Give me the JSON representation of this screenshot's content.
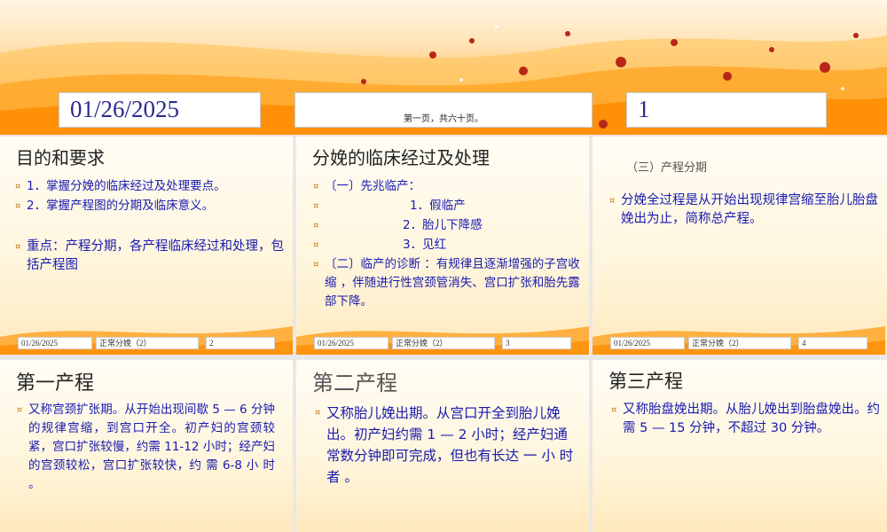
{
  "header": {
    "date": "01/26/2025",
    "page_info": "第一页，共六十页。",
    "page_number": "1"
  },
  "slides": [
    {
      "title": "目的和要求",
      "bullets": [
        "1．掌握分娩的临床经过及处理要点。",
        "2．掌握产程图的分期及临床意义。",
        "重点：产程分期，各产程临床经过和处理，包括产程图"
      ],
      "footer": {
        "date": "01/26/2025",
        "course": "正常分娩（2）",
        "page": "2"
      }
    },
    {
      "title": "分娩的临床经过及处理",
      "bullets": [
        "〔一〕先兆临产：",
        "1．假临产",
        "2．胎儿下降感",
        "3．见红",
        "〔二〕临产的诊断 ：有规律且逐渐增强的子宫收缩 ，伴随进行性宫颈管消失、宫口扩张和胎先露部下降。"
      ],
      "footer": {
        "date": "01/26/2025",
        "course": "正常分娩（2）",
        "page": "3"
      }
    },
    {
      "subtitle": "（三）产程分期",
      "bullets": [
        "分娩全过程是从开始出现规律宫缩至胎儿胎盘娩出为止，简称总产程。"
      ],
      "footer": {
        "date": "01/26/2025",
        "course": "正常分娩（2）",
        "page": "4"
      }
    },
    {
      "title": "第一产程",
      "bullets": [
        "又称宫颈扩张期。从开始出现间歇 5 — 6 分钟的规律宫缩，到宫口开全。初产妇的宫颈较紧，宫口扩张较慢，约需 11-12 小时；经产妇的宫颈较松，宫口扩张较快，约 需 6-8 小 时 。"
      ]
    },
    {
      "title": "第二产程",
      "bullets": [
        "又称胎儿娩出期。从宫口开全到胎儿娩出。初产妇约需 1 — 2 小时；经产妇通常数分钟即可完成，但也有长达 一 小 时 者 。"
      ]
    },
    {
      "title": "第三产程",
      "bullets": [
        "又称胎盘娩出期。从胎儿娩出到胎盘娩出。约需 5 — 15 分钟，不超过 30 分钟。"
      ]
    }
  ],
  "colors": {
    "accent_text": "#1a1ab0",
    "header_text": "#2b2b8f",
    "banner": "#ff9a1a"
  }
}
